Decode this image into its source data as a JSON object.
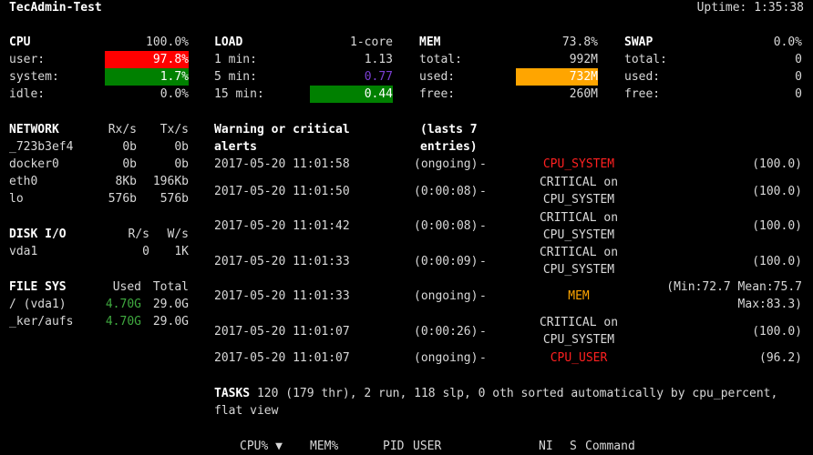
{
  "header": {
    "hostname": "TecAdmin-Test",
    "uptime": "Uptime: 1:35:38"
  },
  "cpu": {
    "title": "CPU",
    "total": "100.0%",
    "rows": [
      {
        "label": "user:",
        "value": "97.8%"
      },
      {
        "label": "system:",
        "value": "1.7%"
      },
      {
        "label": "idle:",
        "value": "0.0%"
      }
    ]
  },
  "load": {
    "title": "LOAD",
    "cores": "1-core",
    "rows": [
      {
        "label": "1 min:",
        "value": "1.13"
      },
      {
        "label": "5 min:",
        "value": "0.77"
      },
      {
        "label": "15 min:",
        "value": "0.44"
      }
    ]
  },
  "mem": {
    "title": "MEM",
    "percent": "73.8%",
    "rows": [
      {
        "label": "total:",
        "value": "992M"
      },
      {
        "label": "used:",
        "value": "732M"
      },
      {
        "label": "free:",
        "value": "260M"
      }
    ]
  },
  "swap": {
    "title": "SWAP",
    "percent": "0.0%",
    "rows": [
      {
        "label": "total:",
        "value": "0"
      },
      {
        "label": "used:",
        "value": "0"
      },
      {
        "label": "free:",
        "value": "0"
      }
    ]
  },
  "network": {
    "title": "NETWORK",
    "col_rx": "Rx/s",
    "col_tx": "Tx/s",
    "rows": [
      {
        "name": "_723b3ef4",
        "rx": "0b",
        "tx": "0b"
      },
      {
        "name": "docker0",
        "rx": "0b",
        "tx": "0b"
      },
      {
        "name": "eth0",
        "rx": "8Kb",
        "tx": "196Kb"
      },
      {
        "name": "lo",
        "rx": "576b",
        "tx": "576b"
      }
    ]
  },
  "disk_io": {
    "title": "DISK I/O",
    "col_r": "R/s",
    "col_w": "W/s",
    "rows": [
      {
        "name": "vda1",
        "r": "0",
        "w": "1K"
      }
    ]
  },
  "file_sys": {
    "title": "FILE SYS",
    "col_used": "Used",
    "col_total": "Total",
    "rows": [
      {
        "name": "/ (vda1)",
        "used": "4.70G",
        "total": "29.0G"
      },
      {
        "name": "_ker/aufs",
        "used": "4.70G",
        "total": "29.0G"
      }
    ]
  },
  "alerts": {
    "title_line1": "Warning or critical",
    "title_line2": "alerts",
    "lasts_line1": "(lasts 7",
    "lasts_line2": "entries)",
    "rows": [
      {
        "time": "2017-05-20 11:01:58",
        "duration": "(ongoing)",
        "dash": "-",
        "type_line1": "CPU_SYSTEM",
        "type_line2": "",
        "value": "(100.0)",
        "value_line2": ""
      },
      {
        "time": "2017-05-20 11:01:50",
        "duration": "(0:00:08)",
        "dash": "-",
        "type_line1": "CRITICAL on",
        "type_line2": "CPU_SYSTEM",
        "value": "(100.0)",
        "value_line2": ""
      },
      {
        "time": "2017-05-20 11:01:42",
        "duration": "(0:00:08)",
        "dash": "-",
        "type_line1": "CRITICAL on",
        "type_line2": "CPU_SYSTEM",
        "value": "(100.0)",
        "value_line2": ""
      },
      {
        "time": "2017-05-20 11:01:33",
        "duration": "(0:00:09)",
        "dash": "-",
        "type_line1": "CRITICAL on",
        "type_line2": "CPU_SYSTEM",
        "value": "(100.0)",
        "value_line2": ""
      },
      {
        "time": "2017-05-20 11:01:33",
        "duration": "(ongoing)",
        "dash": "-",
        "type_line1": "MEM",
        "type_line2": "",
        "value": "(Min:72.7 Mean:75.7",
        "value_line2": "Max:83.3)"
      },
      {
        "time": "2017-05-20 11:01:07",
        "duration": "(0:00:26)",
        "dash": "-",
        "type_line1": "CRITICAL on",
        "type_line2": "CPU_SYSTEM",
        "value": "(100.0)",
        "value_line2": ""
      },
      {
        "time": "2017-05-20 11:01:07",
        "duration": "(ongoing)",
        "dash": "-",
        "type_line1": "CPU_USER",
        "type_line2": "",
        "value": "(96.2)",
        "value_line2": ""
      }
    ]
  },
  "tasks": {
    "label": "TASKS",
    "line1": "120 (179 thr), 2 run, 118 slp, 0 oth sorted automatically by cpu_percent,",
    "line2": "flat view"
  },
  "process_header": {
    "cpu": "CPU% ▼",
    "mem": "MEM%",
    "pid": "PID",
    "user": "USER",
    "ni": "NI",
    "s": "S",
    "command": "Command"
  },
  "colors": {
    "background": "#000000",
    "text": "#d8d8d8",
    "bold": "#ffffff",
    "critical_bg": "#ff0000",
    "ok_bg": "#008000",
    "warning_bg": "#ffa500",
    "careful_fg": "#7b3fd4",
    "ok_fg": "#3fa93f",
    "critical_fg": "#ff2020",
    "warning_fg": "#ffa500"
  }
}
